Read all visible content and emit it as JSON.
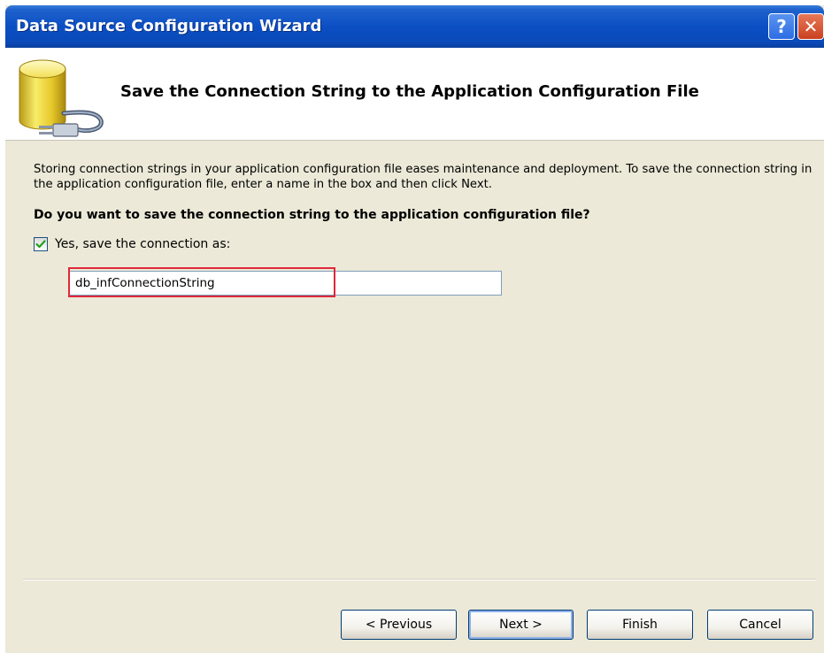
{
  "window": {
    "title": "Data Source Configuration Wizard",
    "help_glyph": "?",
    "close_glyph": "✕"
  },
  "header": {
    "title": "Save the Connection String to the Application Configuration File",
    "icon": "database-plug-icon"
  },
  "body": {
    "description": "Storing connection strings in your application configuration file eases maintenance and deployment. To save the connection string in the application configuration file, enter a name in the box and then click Next.",
    "question": "Do you want to save the connection string to the application configuration file?",
    "save_checkbox": {
      "label": "Yes, save the connection as:",
      "checked": true
    },
    "connection_name": {
      "value": "db_infConnectionString"
    }
  },
  "buttons": {
    "previous": "< Previous",
    "next": "Next >",
    "finish": "Finish",
    "cancel": "Cancel"
  },
  "colors": {
    "titlebar": "#0b4fc4",
    "dialog_bg": "#ece9d8",
    "highlight": "#e0283a"
  }
}
